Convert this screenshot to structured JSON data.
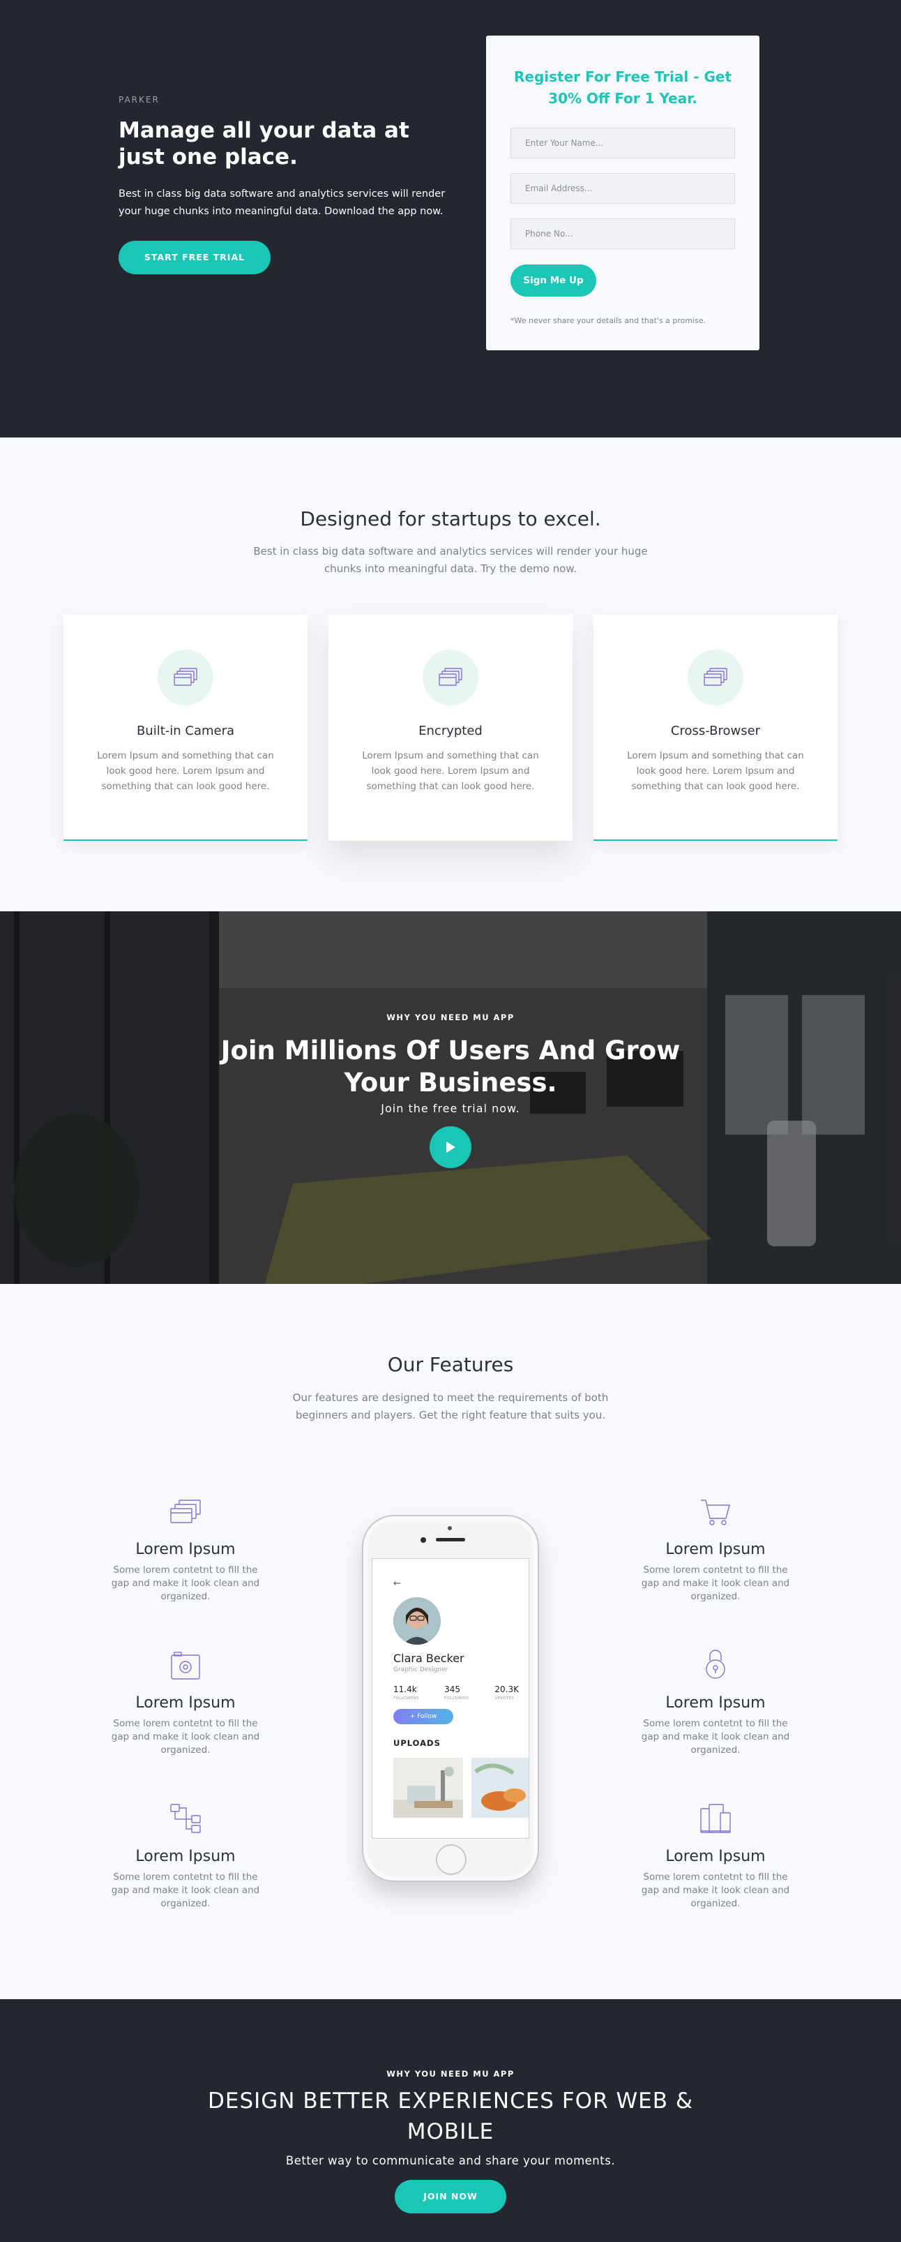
{
  "hero": {
    "brand": "PARKER",
    "title": "Manage all your data at just one place.",
    "description": "Best in class big data software and analytics services will render your huge chunks into meaningful data. Download the app now.",
    "cta_label": "START FREE TRIAL"
  },
  "form": {
    "title": "Register For Free Trial - Get 30% Off For 1 Year.",
    "name_placeholder": "Enter Your Name...",
    "email_placeholder": "Email Address...",
    "phone_placeholder": "Phone No...",
    "submit_label": "Sign Me Up",
    "note": "*We never share your details and that's a promise."
  },
  "startups": {
    "title": "Designed for startups to excel.",
    "subtitle": "Best in class big data software and analytics services will render your huge chunks into meaningful data. Try the demo now.",
    "cards": [
      {
        "title": "Built-in Camera",
        "desc": "Lorem Ipsum and something that can look good here. Lorem Ipsum and something that can look good here.",
        "icon": "cards-icon"
      },
      {
        "title": "Encrypted",
        "desc": "Lorem Ipsum and something that can look good here. Lorem Ipsum and something that can look good here.",
        "icon": "cards-icon"
      },
      {
        "title": "Cross-Browser",
        "desc": "Lorem Ipsum and something that can look good here. Lorem Ipsum and something that can look good here.",
        "icon": "cards-icon"
      }
    ]
  },
  "join": {
    "eyebrow": "WHY YOU NEED MU APP",
    "title": "Join Millions Of Users And Grow Your Business.",
    "subtitle": "Join the free trial now."
  },
  "features": {
    "title": "Our Features",
    "subtitle": "Our features are designed to meet the requirements of both beginners and players. Get the right feature that suits you.",
    "items": [
      {
        "title": "Lorem Ipsum",
        "desc": "Some lorem contetnt to fill the gap and make it look clean and organized.",
        "icon": "cards-icon"
      },
      {
        "title": "Lorem Ipsum",
        "desc": "Some lorem contetnt to fill the gap and make it look clean and organized.",
        "icon": "camera-icon"
      },
      {
        "title": "Lorem Ipsum",
        "desc": "Some lorem contetnt to fill the gap and make it look clean and organized.",
        "icon": "flow-icon"
      },
      {
        "title": "Lorem Ipsum",
        "desc": "Some lorem contetnt to fill the gap and make it look clean and organized.",
        "icon": "cart-icon"
      },
      {
        "title": "Lorem Ipsum",
        "desc": "Some lorem contetnt to fill the gap and make it look clean and organized.",
        "icon": "lock-icon"
      },
      {
        "title": "Lorem Ipsum",
        "desc": "Some lorem contetnt to fill the gap and make it look clean and organized.",
        "icon": "devices-icon"
      }
    ]
  },
  "phone": {
    "name": "Clara Becker",
    "role": "Graphic Designer",
    "stats": [
      {
        "num": "11.4k",
        "label": "FOLLOWERS"
      },
      {
        "num": "345",
        "label": "FOLLOWING"
      },
      {
        "num": "20.3K",
        "label": "UPVOTES"
      }
    ],
    "follow_label": "+ Follow",
    "uploads_label": "UPLOADS"
  },
  "cta": {
    "eyebrow": "WHY YOU NEED MU APP",
    "title": "DESIGN BETTER EXPERIENCES FOR WEB & MOBILE",
    "subtitle": "Better way to communicate and share your moments.",
    "button_label": "JOIN NOW"
  },
  "colors": {
    "accent": "#1ac6b6",
    "dark": "#232830",
    "light_bg": "#f8f9fd",
    "icon_purple": "#8a6fd6"
  }
}
